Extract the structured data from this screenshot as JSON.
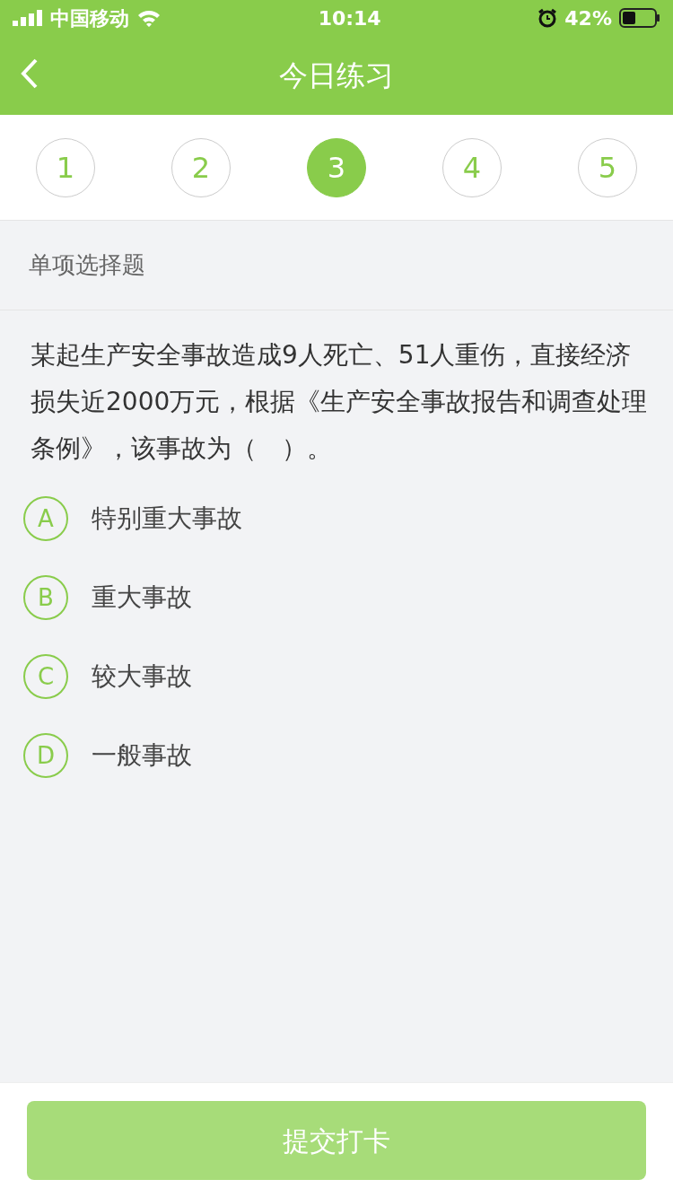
{
  "status_bar": {
    "carrier": "中国移动",
    "time": "10:14",
    "battery": "42%"
  },
  "nav": {
    "title": "今日练习"
  },
  "steps": [
    {
      "label": "1",
      "selected": false
    },
    {
      "label": "2",
      "selected": false
    },
    {
      "label": "3",
      "selected": true
    },
    {
      "label": "4",
      "selected": false
    },
    {
      "label": "5",
      "selected": false
    }
  ],
  "question_type": "单项选择题",
  "question": "某起生产安全事故造成9人死亡、51人重伤，直接经济损失近2000万元，根据《生产安全事故报告和调查处理条例》，该事故为（　）。",
  "options": [
    {
      "letter": "A",
      "text": "特别重大事故",
      "selected": false
    },
    {
      "letter": "B",
      "text": "重大事故",
      "selected": false
    },
    {
      "letter": "C",
      "text": "较大事故",
      "selected": false
    },
    {
      "letter": "D",
      "text": "一般事故",
      "selected": false
    }
  ],
  "submit": {
    "label": "提交打卡",
    "disabled": true
  }
}
